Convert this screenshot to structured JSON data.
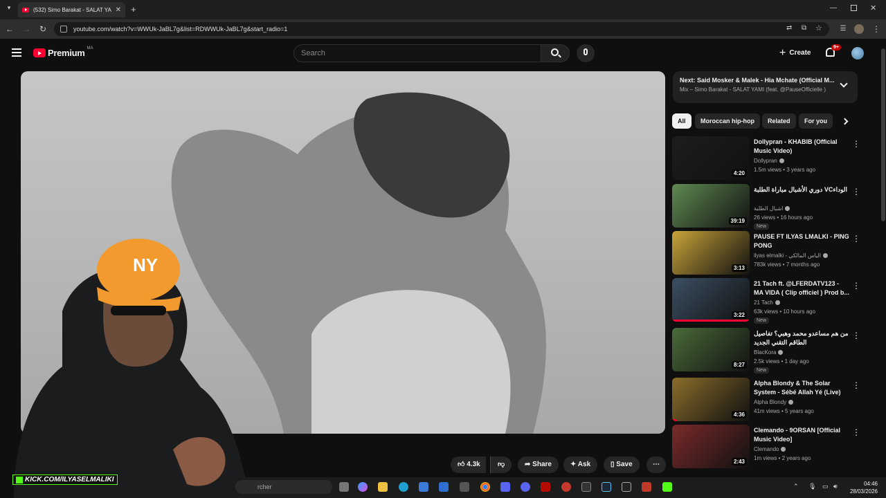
{
  "browser": {
    "tab_title": "(532) Simo Barakat - SALAT YA…",
    "url": "youtube.com/watch?v=WWUk-JaBL7g&list=RDWWUk-JaBL7g&start_radio=1"
  },
  "header": {
    "logo_text": "Premium",
    "country": "MA",
    "search_placeholder": "Search",
    "create_label": "Create",
    "notifications_badge": "9+"
  },
  "next_card": {
    "title": "Next: Said Mosker & Malek - Hia Mchate (Official M...",
    "subtitle": "Mix – Simo Barakat - SALAT YAMI (feat. @PauseOfficielle )"
  },
  "chips": [
    "All",
    "Moroccan hip-hop",
    "Related",
    "For you"
  ],
  "recommendations": [
    {
      "title": "Dollypran - KHABIB (Official Music Video)",
      "channel": "Dollypran",
      "meta": "1.5m views • 3 years ago",
      "duration": "4:20",
      "is_new": false,
      "thumb_color": "#1d1d1d",
      "progress": 0
    },
    {
      "title": "دوري الأشبال مباراة الطلبة VCالوداء",
      "channel": "اشبال الطلبة",
      "meta": "26 views • 16 hours ago",
      "duration": "39:19",
      "is_new": true,
      "thumb_color": "#5f8a52",
      "progress": 0
    },
    {
      "title": "PAUSE FT ILYAS LMALKI - PING PONG",
      "channel": "ilyas elmalki - الياس المالكي",
      "meta": "783k views • 7 months ago",
      "duration": "3:13",
      "is_new": false,
      "thumb_color": "#c9a43a",
      "progress": 0
    },
    {
      "title": "21 Tach ft. @LFERDATV123 - MA VIDA ( Clip officiel ) Prod b...",
      "channel": "21 Tach",
      "meta": "63k views • 10 hours ago",
      "duration": "3:22",
      "is_new": true,
      "thumb_color": "#3b4f63",
      "progress": 1
    },
    {
      "title": "من هم مساعدو محمد وهبي؟ تفاصيل الطاقم التقني الجديد",
      "channel": "BlacKora",
      "meta": "2.5k views • 1 day ago",
      "duration": "8:27",
      "is_new": true,
      "thumb_color": "#4a6b3a",
      "progress": 0
    },
    {
      "title": "Alpha Blondy & The Solar System - Sébé Allah Yé (Live)",
      "channel": "Alpha Blondy",
      "meta": "41m views • 5 years ago",
      "duration": "4:36",
      "is_new": false,
      "thumb_color": "#8a6d2a",
      "progress": 0.05
    },
    {
      "title": "Clemando - 9ORSAN [Official Music Video]",
      "channel": "Clemando",
      "meta": "1m views • 2 years ago",
      "duration": "2:43",
      "is_new": false,
      "thumb_color": "#7a2a2a",
      "progress": 0
    }
  ],
  "actions": {
    "likes": "4.3k",
    "share": "Share",
    "ask": "Ask",
    "save": "Save"
  },
  "overlay": {
    "kick_text": "KICK.COM/ILYASELMALIKI"
  },
  "taskbar": {
    "search_placeholder": "rcher",
    "time": "04:46",
    "date": "28/03/2026"
  }
}
